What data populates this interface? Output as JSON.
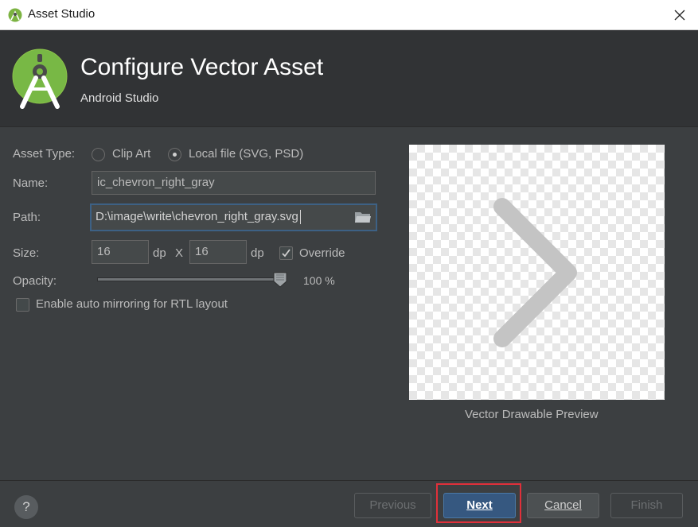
{
  "window": {
    "title": "Asset Studio"
  },
  "header": {
    "title": "Configure Vector Asset",
    "subtitle": "Android Studio"
  },
  "form": {
    "asset_type_label": "Asset Type:",
    "asset_type_options": [
      "Clip Art",
      "Local file (SVG, PSD)"
    ],
    "asset_type_selected": "Local file (SVG, PSD)",
    "name_label": "Name:",
    "name_value": "ic_chevron_right_gray",
    "path_label": "Path:",
    "path_value": "D:\\image\\write\\chevron_right_gray.svg",
    "size_label": "Size:",
    "width_value": "16",
    "height_value": "16",
    "unit": "dp",
    "size_separator": "X",
    "override_label": "Override",
    "override_checked": true,
    "opacity_label": "Opacity:",
    "opacity_value": 100,
    "opacity_text": "100 %",
    "mirroring_label": "Enable auto mirroring for RTL layout",
    "mirroring_checked": false
  },
  "preview": {
    "caption": "Vector Drawable Preview",
    "icon": "chevron-right-icon"
  },
  "footer": {
    "help_label": "?",
    "previous_label": "Previous",
    "next_label": "Next",
    "cancel_label": "Cancel",
    "finish_label": "Finish"
  },
  "colors": {
    "background": "#3c3f41",
    "header_background": "#313335",
    "accent": "#365880",
    "highlight": "#e0303a",
    "chevron": "#c4c4c4"
  }
}
